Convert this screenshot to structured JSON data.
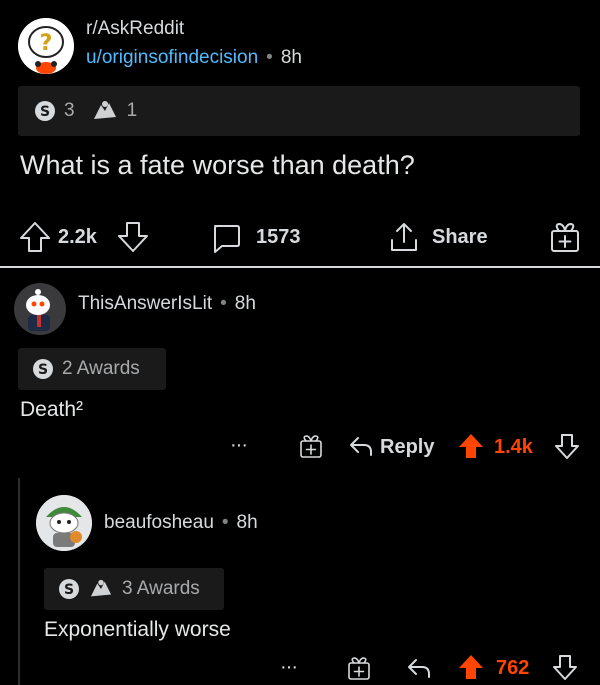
{
  "post": {
    "subreddit": "r/AskReddit",
    "author": "u/originsofindecision",
    "separator": "•",
    "age": "8h",
    "award_count_silver": "3",
    "award_count_helpful": "1",
    "title": "What is a fate worse than death?",
    "score": "2.2k",
    "comments": "1573",
    "share_label": "Share"
  },
  "comment1": {
    "author": "ThisAnswerIsLit",
    "separator": "•",
    "age": "8h",
    "awards_label": "2 Awards",
    "body": "Death²",
    "more": "···",
    "reply_label": "Reply",
    "score": "1.4k"
  },
  "comment2": {
    "author": "beaufosheau",
    "separator": "•",
    "age": "8h",
    "awards_label": "3 Awards",
    "body": "Exponentially worse",
    "more": "···",
    "score": "762"
  },
  "colors": {
    "background": "#000000",
    "text": "#d7dadc",
    "muted": "#818384",
    "username_link": "#4fbcff",
    "upvote": "#ff4500"
  }
}
